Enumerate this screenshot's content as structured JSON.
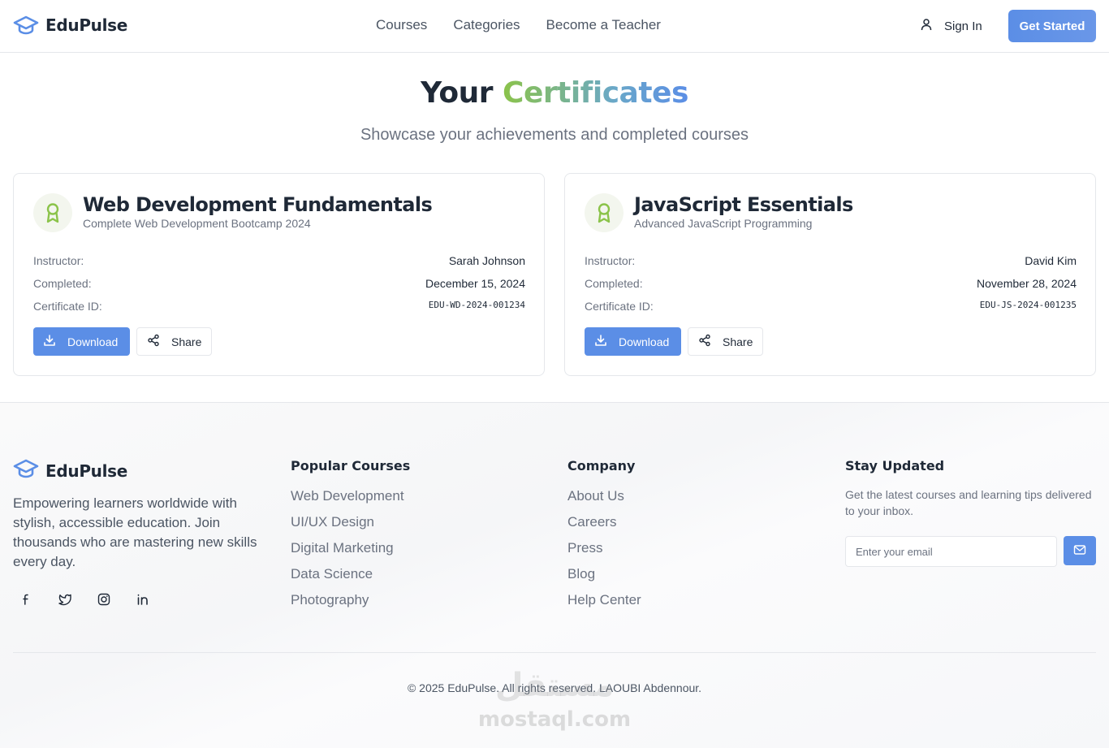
{
  "brand": {
    "name": "EduPulse",
    "accent": "#5b8ee6",
    "green": "#8bc34a",
    "icon": "graduation-cap-icon"
  },
  "header": {
    "nav": [
      "Courses",
      "Categories",
      "Become a Teacher"
    ],
    "sign_in": "Sign In",
    "get_started": "Get Started"
  },
  "hero": {
    "title_plain": "Your",
    "title_highlight": "Certificates",
    "subtitle": "Showcase your achievements and completed courses"
  },
  "labels": {
    "instructor": "Instructor:",
    "completed": "Completed:",
    "certificate_id": "Certificate ID:",
    "download": "Download",
    "share": "Share"
  },
  "certificates": [
    {
      "title": "Web Development Fundamentals",
      "course": "Complete Web Development Bootcamp 2024",
      "instructor": "Sarah Johnson",
      "completed": "December 15, 2024",
      "id": "EDU-WD-2024-001234"
    },
    {
      "title": "JavaScript Essentials",
      "course": "Advanced JavaScript Programming",
      "instructor": "David Kim",
      "completed": "November 28, 2024",
      "id": "EDU-JS-2024-001235"
    }
  ],
  "footer": {
    "description": "Empowering learners worldwide with stylish, accessible education. Join thousands who are mastering new skills every day.",
    "socials": [
      "facebook-icon",
      "twitter-icon",
      "instagram-icon",
      "linkedin-icon"
    ],
    "popular_courses": {
      "heading": "Popular Courses",
      "items": [
        "Web Development",
        "UI/UX Design",
        "Digital Marketing",
        "Data Science",
        "Photography"
      ]
    },
    "company": {
      "heading": "Company",
      "items": [
        "About Us",
        "Careers",
        "Press",
        "Blog",
        "Help Center"
      ]
    },
    "newsletter": {
      "heading": "Stay Updated",
      "text": "Get the latest courses and learning tips delivered to your inbox.",
      "placeholder": "Enter your email"
    },
    "copyright": "© 2025 EduPulse. All rights reserved. LAOUBI Abdennour.",
    "watermark_ar": "مستقل",
    "watermark_en": "mostaql.com"
  }
}
